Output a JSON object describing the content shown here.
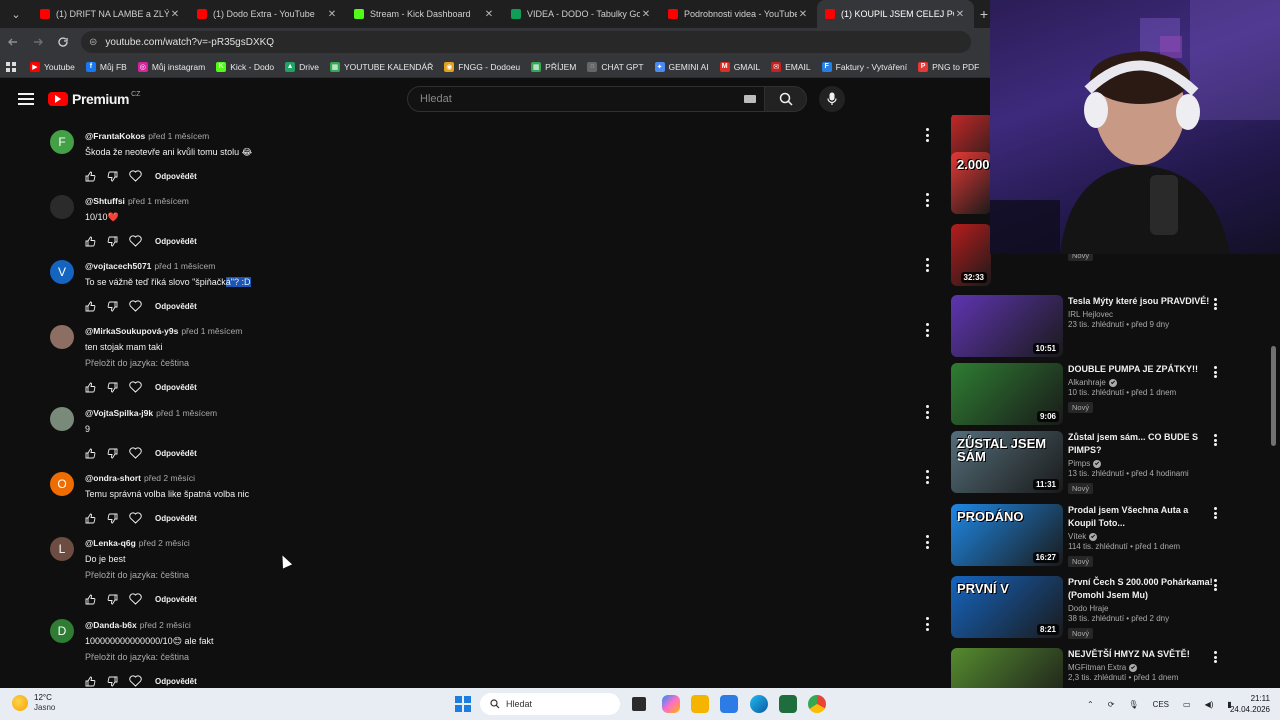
{
  "browser": {
    "tabs": [
      {
        "label": "(1) DRIFT NA LAMBE a ZLÝ N",
        "icon": "youtube-favicon",
        "active": false
      },
      {
        "label": "(1) Dodo Extra - YouTube",
        "icon": "youtube-favicon",
        "active": false
      },
      {
        "label": "Stream - Kick Dashboard",
        "icon": "kick-favicon",
        "active": false
      },
      {
        "label": "VIDEA - DODO - Tabulky Googl",
        "icon": "sheets-favicon",
        "active": false
      },
      {
        "label": "Podrobnosti videa - YouTube St",
        "icon": "youtube-studio-favicon",
        "active": false
      },
      {
        "label": "(1) KOUPIL JSEM CELEJ PC SETU",
        "icon": "youtube-favicon",
        "active": true
      }
    ],
    "close_glyph": "✕",
    "new_tab_glyph": "+",
    "address": "youtube.com/watch?v=-pR35gsDXKQ",
    "bookmarks": [
      {
        "label": "Youtube",
        "color": "#ff0000",
        "glyph": "▶"
      },
      {
        "label": "Můj FB",
        "color": "#1877f2",
        "glyph": "f"
      },
      {
        "label": "Můj instagram",
        "color": "#d6249f",
        "glyph": "◎"
      },
      {
        "label": "Kick - Dodo",
        "color": "#53fc18",
        "glyph": "K"
      },
      {
        "label": "Drive",
        "color": "#1fa463",
        "glyph": "▲"
      },
      {
        "label": "YOUTUBE KALENDÁŘ",
        "color": "#34a853",
        "glyph": "▦"
      },
      {
        "label": "FNGG - Dodoeu",
        "color": "#e0a020",
        "glyph": "◉"
      },
      {
        "label": "PŘÍJEM",
        "color": "#34a853",
        "glyph": "▦"
      },
      {
        "label": "CHAT GPT",
        "color": "#666666",
        "glyph": "◌"
      },
      {
        "label": "GEMINI AI",
        "color": "#4a8af4",
        "glyph": "✦"
      },
      {
        "label": "GMAIL",
        "color": "#d93025",
        "glyph": "M"
      },
      {
        "label": "EMAIL",
        "color": "#c5221f",
        "glyph": "✉"
      },
      {
        "label": "Faktury - Vytváření",
        "color": "#2a7de1",
        "glyph": "F"
      },
      {
        "label": "PNG to PDF",
        "color": "#e53935",
        "glyph": "P"
      },
      {
        "label": "",
        "color": "#222222",
        "glyph": "▬"
      },
      {
        "label": "htt",
        "color": "#e53935",
        "glyph": "ϟ"
      }
    ]
  },
  "youtube": {
    "brand": "Premium",
    "region": "CZ",
    "search_placeholder": "Hledat"
  },
  "comments": [
    {
      "author": "@FrantaKokos",
      "time": "před 1 měsícem",
      "text": "Škoda že neotevře ani kvůli tomu stolu 😂",
      "text_highlight": "",
      "translate": "",
      "avatar_letter": "F",
      "avatar_color": "#43a047",
      "reply_label": "Odpovědět"
    },
    {
      "author": "@Shtuffsi",
      "time": "před 1 měsícem",
      "text": "10/10❤️",
      "text_highlight": "",
      "translate": "",
      "avatar_letter": "",
      "avatar_color": "#2b2b2b",
      "reply_label": "Odpovědět"
    },
    {
      "author": "@vojtacech5071",
      "time": "před 1 měsícem",
      "text": "To se vážně teď říká slovo \"špiňačk",
      "text_highlight": "á\"? :D",
      "translate": "",
      "avatar_letter": "V",
      "avatar_color": "#1565c0",
      "reply_label": "Odpovědět"
    },
    {
      "author": "@MirkaSoukupová-y9s",
      "time": "před 1 měsícem",
      "text": "ten stojak mam taki",
      "text_highlight": "",
      "translate": "Přeložit do jazyka: čeština",
      "avatar_letter": "",
      "avatar_color": "#8d6e63",
      "reply_label": "Odpovědět"
    },
    {
      "author": "@VojtaSpilka-j9k",
      "time": "před 1 měsícem",
      "text": "9",
      "text_highlight": "",
      "translate": "",
      "avatar_letter": "",
      "avatar_color": "#7a8a7a",
      "reply_label": "Odpovědět"
    },
    {
      "author": "@ondra-short",
      "time": "před 2 měsíci",
      "text": "Temu správná volba like špatná volba nic",
      "text_highlight": "",
      "translate": "",
      "avatar_letter": "O",
      "avatar_color": "#ef6c00",
      "reply_label": "Odpovědět"
    },
    {
      "author": "@Lenka-q6g",
      "time": "před 2 měsíci",
      "text": "Do je best",
      "text_highlight": "",
      "translate": "Přeložit do jazyka: čeština",
      "avatar_letter": "L",
      "avatar_color": "#6d4c41",
      "reply_label": "Odpovědět"
    },
    {
      "author": "@Danda-b6x",
      "time": "před 2 měsíci",
      "text": "100000000000000/10😊 ale fakt",
      "text_highlight": "",
      "translate": "Přeložit do jazyka: čeština",
      "avatar_letter": "D",
      "avatar_color": "#2e7d32",
      "reply_label": "Odpovědět"
    }
  ],
  "recommendations": [
    {
      "title": "",
      "channel": "",
      "meta": "",
      "badge": "",
      "duration": "",
      "thumb_color": "#c62828",
      "thumb_text": "",
      "verified": false
    },
    {
      "title": "",
      "channel": "",
      "meta": "",
      "badge": "",
      "duration": "",
      "thumb_color": "#e53935",
      "thumb_text": "2.000",
      "verified": false
    },
    {
      "title": "",
      "channel": "MGFitman",
      "meta": "110 tis. zhlédnutí • před 2 dny",
      "badge": "Nový",
      "duration": "32:33",
      "thumb_color": "#b71c1c",
      "thumb_text": "",
      "verified": true
    },
    {
      "title": "Tesla Mýty které jsou PRAVDIVÉ!",
      "channel": "IRL Hejlovec",
      "meta": "23 tis. zhlédnutí • před 9 dny",
      "badge": "",
      "duration": "10:51",
      "thumb_color": "#5e35b1",
      "thumb_text": "",
      "verified": false
    },
    {
      "title": "DOUBLE PUMPA JE ZPÁTKY!!",
      "channel": "Alkanhraje",
      "meta": "10 tis. zhlédnutí • před 1 dnem",
      "badge": "Nový",
      "duration": "9:06",
      "thumb_color": "#2e7d32",
      "thumb_text": "",
      "verified": true
    },
    {
      "title": "Zůstal jsem sám... CO BUDE S PIMPS?",
      "channel": "Pimps",
      "meta": "13 tis. zhlédnutí • před 4 hodinami",
      "badge": "Nový",
      "duration": "11:31",
      "thumb_color": "#546e7a",
      "thumb_text": "ZŮSTAL JSEM SÁM",
      "verified": true
    },
    {
      "title": "Prodal jsem Všechna Auta a Koupil Toto...",
      "channel": "Vítek",
      "meta": "114 tis. zhlédnutí • před 1 dnem",
      "badge": "Nový",
      "duration": "16:27",
      "thumb_color": "#1e88e5",
      "thumb_text": "PRODÁNO",
      "verified": true
    },
    {
      "title": "První Čech S 200.000 Pohárkama! (Pomohl Jsem Mu)",
      "channel": "Dodo Hraje",
      "meta": "38 tis. zhlédnutí • před 2 dny",
      "badge": "Nový",
      "duration": "8:21",
      "thumb_color": "#1565c0",
      "thumb_text": "PRVNÍ V",
      "verified": false
    },
    {
      "title": "NEJVĚTŠÍ HMYZ NA SVĚTĚ!",
      "channel": "MGFitman Extra",
      "meta": "2,3 tis. zhlédnutí • před 1 dnem",
      "badge": "",
      "duration": "",
      "thumb_color": "#558b2f",
      "thumb_text": "",
      "verified": true
    }
  ],
  "taskbar": {
    "temperature": "12°C",
    "weather": "Jasno",
    "search_placeholder": "Hledat",
    "language": "CES",
    "time": "21:11",
    "date": "24.04.2026"
  }
}
